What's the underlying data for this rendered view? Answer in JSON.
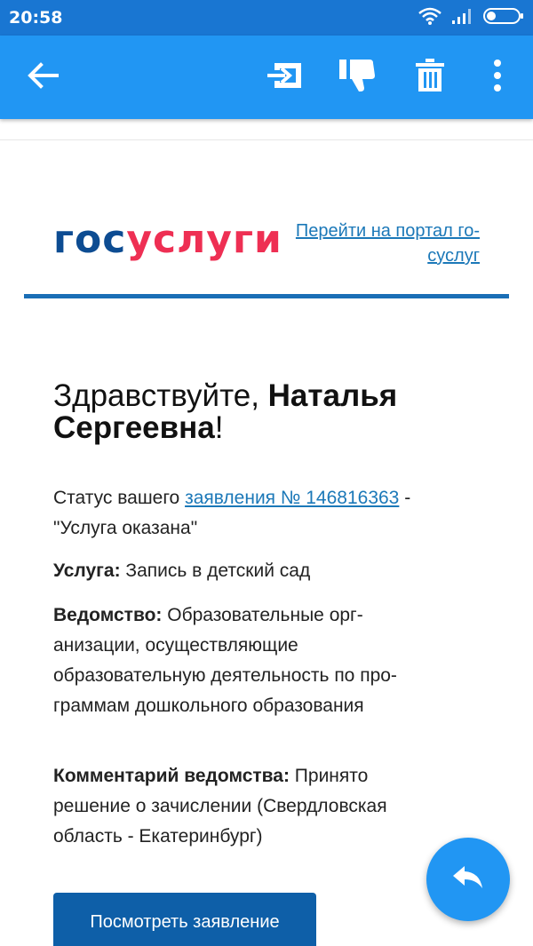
{
  "status_bar": {
    "time": "20:58",
    "icons": [
      "wifi-icon",
      "signal-icon",
      "battery-icon"
    ]
  },
  "toolbar": {
    "icons": [
      "back-arrow-icon",
      "move-to-folder-icon",
      "thumbs-down-icon",
      "trash-icon",
      "more-vert-icon"
    ]
  },
  "email": {
    "logo_part1": "гос",
    "logo_part2": "услуги",
    "logo_colors": {
      "part1": "#0d4c92",
      "part2": "#ee2f53"
    },
    "portal_link_line1": "Перейти на портал го-",
    "portal_link_line2": "суслуг",
    "greeting_prefix": "Здравствуйте, ",
    "greeting_name_line1": "Наталья",
    "greeting_name_line2": "Сергеевна",
    "greeting_suffix": "!",
    "status_prefix": "Статус вашего ",
    "status_link": "заявления № 146816363",
    "status_sep": " -",
    "status_value": "\"Услуга оказана\"",
    "service_label": "Услуга:",
    "service_value": " Запись в детский сад",
    "department_label": "Ведомство:",
    "department_line1": " Образовательные орг-",
    "department_line2": "анизации, осуществляющие",
    "department_line3": "образовательную деятельность по про-",
    "department_line4": "граммам дошкольного образования",
    "comment_label": "Комментарий ведомства:",
    "comment_line1": " Принято",
    "comment_line2": "решение о зачислении (Свердловская",
    "comment_line3": "область - Екатеринбург)",
    "button_label": "Посмотреть заявление"
  },
  "fab": {
    "icon": "reply-icon"
  },
  "colors": {
    "toolbar": "#2196f3",
    "status_bar": "#1976d2",
    "link": "#1b78b8",
    "rule": "#1a6eb6",
    "button": "#0e5fa8"
  }
}
